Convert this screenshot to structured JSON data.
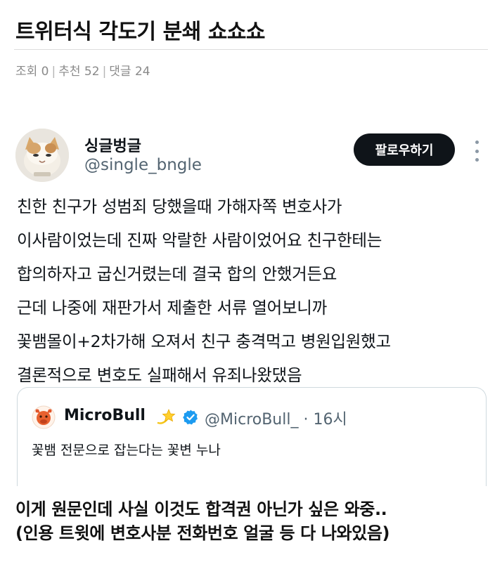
{
  "post": {
    "title": "트위터식 각도기 분쇄 쇼쇼쇼",
    "meta": {
      "views": "조회 0",
      "recommends": "추천 52",
      "comments": "댓글 24"
    }
  },
  "tweet": {
    "display_name": "싱글벙글",
    "handle": "@single_bngle",
    "follow_label": "팔로우하기",
    "avatar_icon": "cat-avatar",
    "body_lines": [
      "친한 친구가 성범죄 당했을때 가해자쪽 변호사가",
      "이사람이었는데 진짜 악랄한 사람이었어요 친구한테는",
      "합의하자고 굽신거렸는데 결국 합의 안했거든요",
      "근데 나중에 재판가서 제출한 서류 열어보니까",
      "꽃뱀몰이+2차가해 오져서 친구 충격먹고 병원입원했고",
      "결론적으로 변호도 실패해서 유죄나왔댔음"
    ]
  },
  "quote": {
    "name": "MicroBull",
    "handle_time": "@MicroBull_ · 16시",
    "text": "꽃뱀 전문으로 잡는다는 꽃변 누나",
    "avatar_icon": "bull-logo",
    "verified_color": "#1d9bf0"
  },
  "caption": {
    "lines": [
      "이게 원문인데 사실 이것도 합격권 아닌가 싶은 와중..",
      "(인용 트윗에 변호사분 전화번호 얼굴 등 다 나와있음)"
    ]
  }
}
